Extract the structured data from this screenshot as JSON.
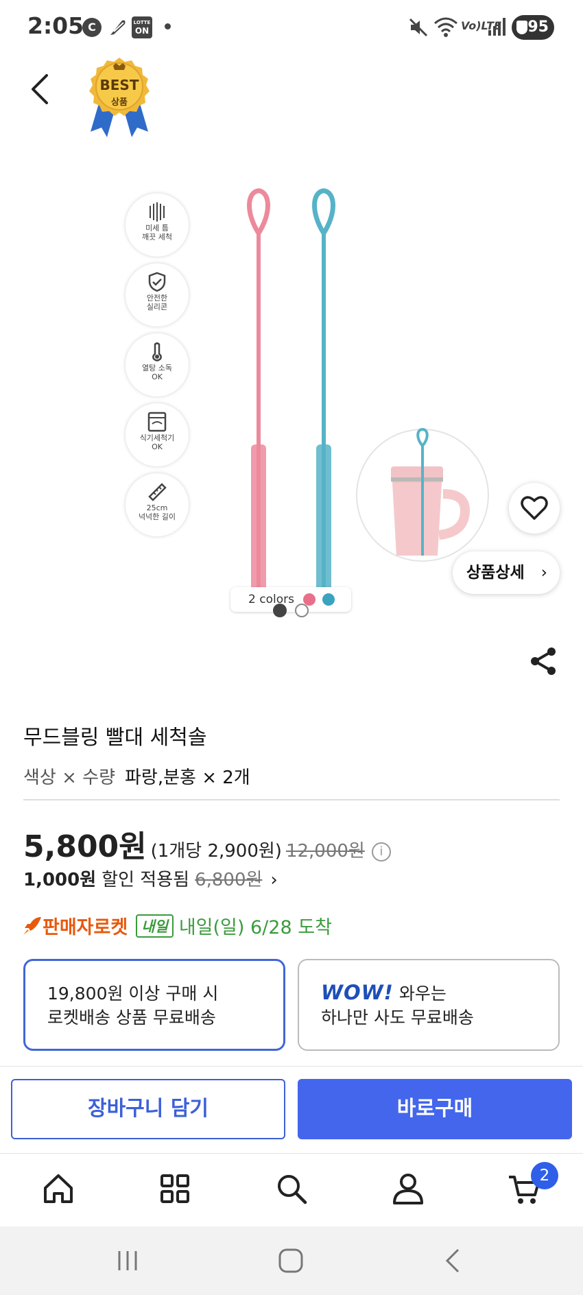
{
  "status_bar": {
    "time": "2:05",
    "icons": [
      "c-badge-icon",
      "feather-icon",
      "lotte-on-icon",
      "dot-icon",
      "mute-icon",
      "wifi-icon",
      "volte-icon",
      "signal-icon",
      "battery-icon"
    ],
    "lotte_top": "LOTTE",
    "lotte_bottom": "ON",
    "c_badge": "C",
    "volte": "Vo)LTE",
    "battery": "95"
  },
  "header": {
    "badge_top": "BEST",
    "badge_bottom": "상품"
  },
  "product_image": {
    "features": [
      {
        "line1": "미세 틈",
        "line2": "깨끗 세척",
        "icon": "scrub-icon"
      },
      {
        "line1": "안전한",
        "line2": "실리콘",
        "icon": "shield-check-icon"
      },
      {
        "line1": "열탕 소독",
        "line2": "OK",
        "icon": "thermometer-icon"
      },
      {
        "line1": "식기세척기",
        "line2": "OK",
        "icon": "dishwasher-icon"
      },
      {
        "line1": "25cm",
        "line2": "넉넉한 길이",
        "icon": "ruler-icon"
      }
    ],
    "colors_label": "2 colors",
    "color_swatches": [
      "#e8708a",
      "#3aa3c0"
    ],
    "slide_current": 1,
    "slide_total": 2,
    "detail_button": "상품상세",
    "colors": {
      "pink": "#ec8a9c",
      "blue": "#56b3c7"
    }
  },
  "product": {
    "title": "무드블링 빨대 세척솔",
    "option_label": "색상 × 수량",
    "option_value": "파랑,분홍 × 2개",
    "price": "5,800원",
    "unit_price": "(1개당 2,900원)",
    "original_price": "12,000원",
    "discount_amount": "1,000원",
    "discount_label": "할인 적용됨",
    "discount_original": "6,800원",
    "rocket_label": "판매자로켓",
    "tomorrow_badge": "내일",
    "arrival": "내일(일) 6/28 도착"
  },
  "shipping": {
    "left_line1": "19,800원 이상 구매 시",
    "left_line2": "로켓배송 상품 무료배송",
    "wow_logo": "WOW!",
    "right_line1_suffix": "와우는",
    "right_line2": "하나만 사도 무료배송"
  },
  "actions": {
    "add_to_cart": "장바구니 담기",
    "buy_now": "바로구매"
  },
  "bottom_nav": {
    "items": [
      "home-icon",
      "categories-icon",
      "search-icon",
      "account-icon",
      "cart-icon"
    ],
    "cart_count": "2"
  },
  "theme": {
    "accent_blue": "#4366ec",
    "rocket_orange": "#e8590c",
    "arrival_green": "#3b9b3b"
  }
}
